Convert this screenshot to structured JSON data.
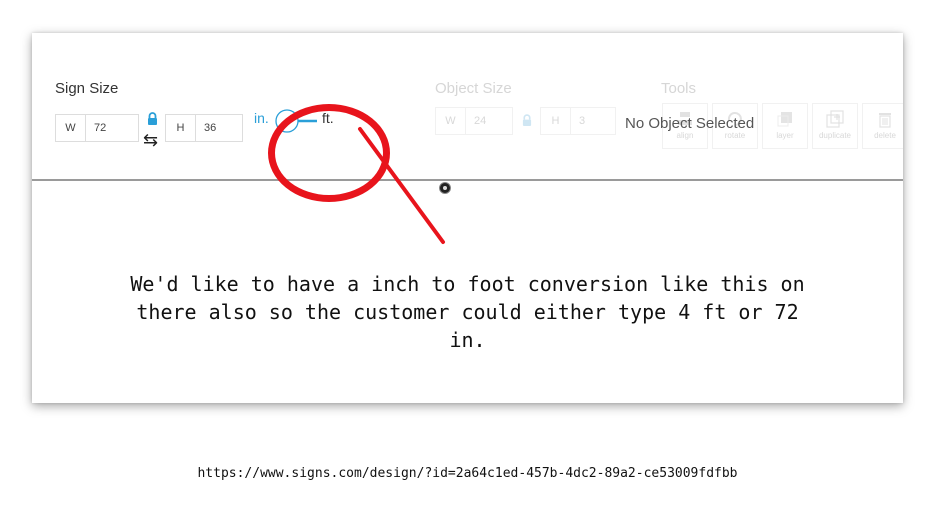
{
  "sign_size": {
    "title": "Sign Size",
    "width_prefix": "W",
    "width_value": "72",
    "height_prefix": "H",
    "height_value": "36",
    "unit_in": "in.",
    "unit_ft": "ft."
  },
  "object_size": {
    "title": "Object Size",
    "width_prefix": "W",
    "width_value": "24",
    "height_prefix": "H",
    "height_value": "3"
  },
  "tools": {
    "title": "Tools",
    "status": "No Object Selected",
    "buttons": [
      {
        "label": "align",
        "icon": "align-icon"
      },
      {
        "label": "rotate",
        "icon": "rotate-icon"
      },
      {
        "label": "layer",
        "icon": "layer-icon"
      },
      {
        "label": "duplicate",
        "icon": "duplicate-icon"
      },
      {
        "label": "delete",
        "icon": "trash-icon"
      }
    ]
  },
  "annotation": {
    "note": "We'd like to have a inch to foot conversion like this on there also so the customer could either type 4 ft or 72 in.",
    "color": "#e8141c"
  },
  "url": "https://www.signs.com/design/?id=2a64c1ed-457b-4dc2-89a2-ce53009fdfbb"
}
